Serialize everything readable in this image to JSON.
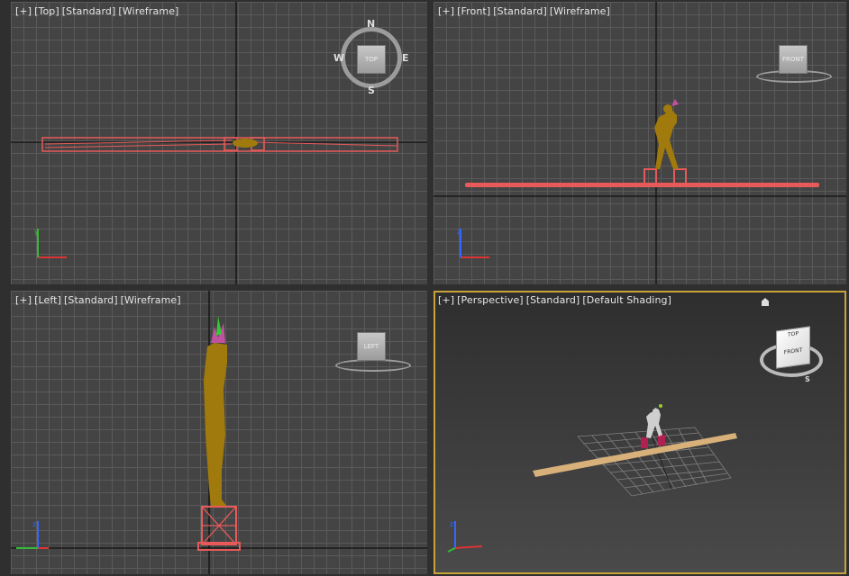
{
  "viewports": {
    "top": {
      "labels": [
        "[+]",
        "[Top]",
        "[Standard]",
        "[Wireframe]"
      ],
      "viewcube": "TOP",
      "compass": {
        "n": "N",
        "s": "S",
        "e": "E",
        "w": "W"
      }
    },
    "front": {
      "labels": [
        "[+]",
        "[Front]",
        "[Standard]",
        "[Wireframe]"
      ],
      "viewcube": "FRONT"
    },
    "left": {
      "labels": [
        "[+]",
        "[Left]",
        "[Standard]",
        "[Wireframe]"
      ],
      "viewcube": "LEFT"
    },
    "perspective": {
      "labels": [
        "[+]",
        "[Perspective]",
        "[Standard]",
        "[Default Shading]"
      ],
      "viewcube": "FRONT",
      "viewcube_top": "TOP",
      "compass_s": "S"
    }
  },
  "axes": {
    "x": "x",
    "y": "y",
    "z": "z"
  },
  "colors": {
    "accent_active": "#c9a33a",
    "wire_red": "#e85a5a",
    "figure": "#a07a0c",
    "plank": "#d8b07a"
  }
}
